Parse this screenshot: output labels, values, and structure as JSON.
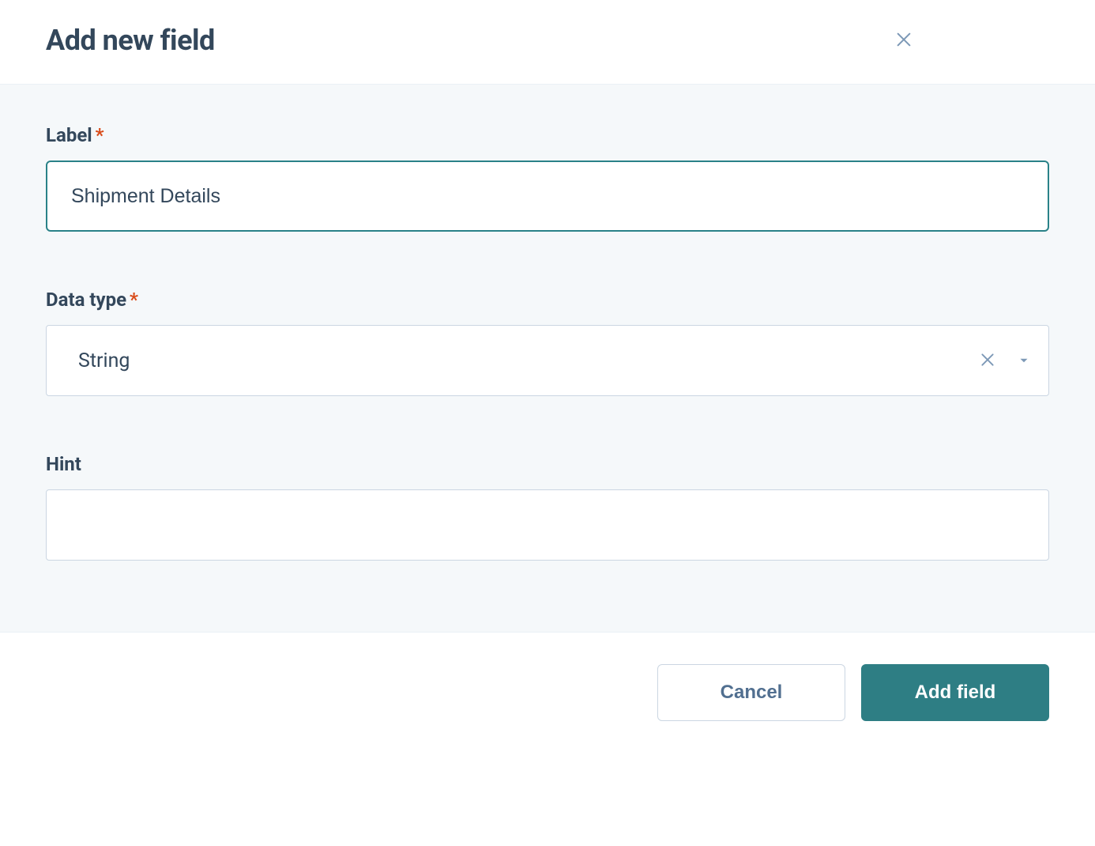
{
  "dialog": {
    "title": "Add new field"
  },
  "form": {
    "label_field": {
      "label": "Label",
      "required_mark": "*",
      "value": "Shipment Details"
    },
    "data_type_field": {
      "label": "Data type",
      "required_mark": "*",
      "selected": "String"
    },
    "hint_field": {
      "label": "Hint",
      "value": ""
    }
  },
  "footer": {
    "cancel_label": "Cancel",
    "submit_label": "Add field"
  },
  "colors": {
    "accent": "#2e7e84",
    "text": "#33475b",
    "muted": "#7c98b6",
    "body_bg": "#f5f8fa",
    "border": "#cbd6e2",
    "required": "#d94c1a"
  }
}
